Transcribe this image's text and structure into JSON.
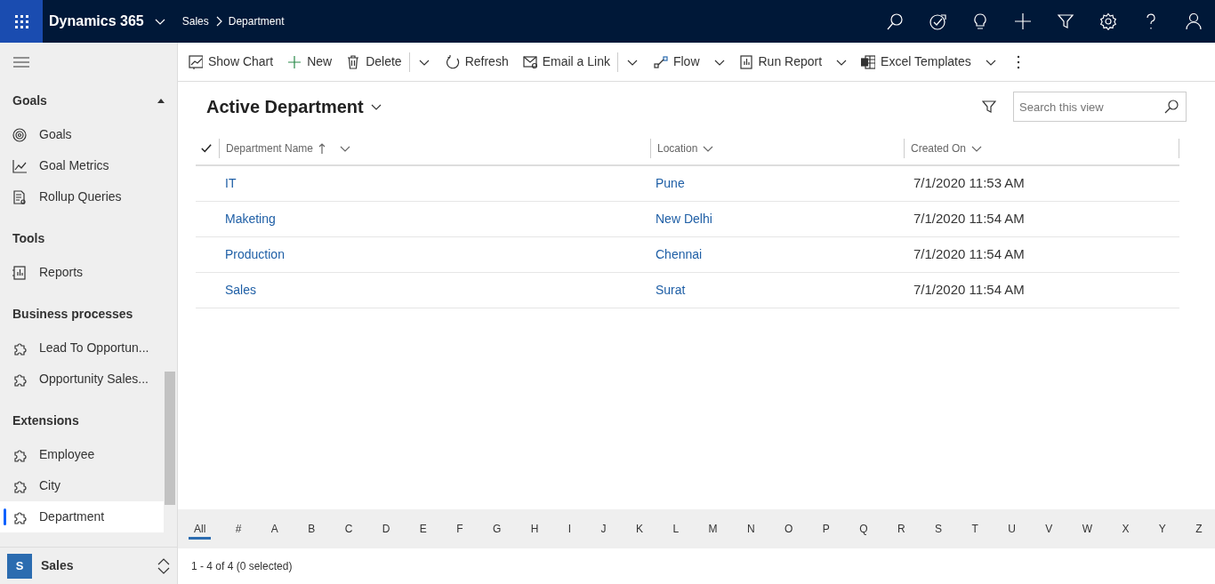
{
  "app": {
    "title": "Dynamics 365",
    "breadcrumb": [
      "Sales",
      "Department"
    ]
  },
  "commands": [
    {
      "kind": "button",
      "label": "Show Chart"
    },
    {
      "kind": "button",
      "label": "New"
    },
    {
      "kind": "button",
      "label": "Delete"
    },
    {
      "kind": "split"
    },
    {
      "kind": "button",
      "label": "Refresh"
    },
    {
      "kind": "button",
      "label": "Email a Link"
    },
    {
      "kind": "split"
    },
    {
      "kind": "menu",
      "label": "Flow"
    },
    {
      "kind": "menu",
      "label": "Run Report"
    },
    {
      "kind": "menu",
      "label": "Excel Templates"
    },
    {
      "kind": "more"
    }
  ],
  "sidebar": {
    "groups": [
      {
        "title": "Goals",
        "expanded": true,
        "items": [
          {
            "label": "Goals",
            "selected": false
          },
          {
            "label": "Goal Metrics",
            "selected": false
          },
          {
            "label": "Rollup Queries",
            "selected": false
          }
        ]
      },
      {
        "title": "Tools",
        "items": [
          {
            "label": "Reports",
            "selected": false
          }
        ]
      },
      {
        "title": "Business processes",
        "items": [
          {
            "label": "Lead To Opportun...",
            "selected": false
          },
          {
            "label": "Opportunity Sales...",
            "selected": false
          }
        ]
      },
      {
        "title": "Extensions",
        "items": [
          {
            "label": "Employee",
            "selected": false
          },
          {
            "label": "City",
            "selected": false
          },
          {
            "label": "Department",
            "selected": true
          }
        ]
      }
    ],
    "area": {
      "initial": "S",
      "label": "Sales"
    }
  },
  "view": {
    "title": "Active Department",
    "search": {
      "placeholder": "Search this view"
    }
  },
  "table": {
    "columns": [
      {
        "label": "Department Name",
        "sorted": true
      },
      {
        "label": "Location",
        "sorted": false
      },
      {
        "label": "Created On",
        "sorted": false
      }
    ],
    "rows": [
      {
        "cells": [
          "IT",
          "Pune",
          "7/1/2020 11:53 AM"
        ]
      },
      {
        "cells": [
          "Maketing",
          "New Delhi",
          "7/1/2020 11:54 AM"
        ]
      },
      {
        "cells": [
          "Production",
          "Chennai",
          "7/1/2020 11:54 AM"
        ]
      },
      {
        "cells": [
          "Sales",
          "Surat",
          "7/1/2020 11:54 AM"
        ]
      }
    ]
  },
  "alphabet": [
    {
      "label": "All",
      "selected": true
    },
    {
      "label": "#",
      "selected": false
    },
    {
      "label": "A",
      "selected": false
    },
    {
      "label": "B",
      "selected": false
    },
    {
      "label": "C",
      "selected": false
    },
    {
      "label": "D",
      "selected": false
    },
    {
      "label": "E",
      "selected": false
    },
    {
      "label": "F",
      "selected": false
    },
    {
      "label": "G",
      "selected": false
    },
    {
      "label": "H",
      "selected": false
    },
    {
      "label": "I",
      "selected": false
    },
    {
      "label": "J",
      "selected": false
    },
    {
      "label": "K",
      "selected": false
    },
    {
      "label": "L",
      "selected": false
    },
    {
      "label": "M",
      "selected": false
    },
    {
      "label": "N",
      "selected": false
    },
    {
      "label": "O",
      "selected": false
    },
    {
      "label": "P",
      "selected": false
    },
    {
      "label": "Q",
      "selected": false
    },
    {
      "label": "R",
      "selected": false
    },
    {
      "label": "S",
      "selected": false
    },
    {
      "label": "T",
      "selected": false
    },
    {
      "label": "U",
      "selected": false
    },
    {
      "label": "V",
      "selected": false
    },
    {
      "label": "W",
      "selected": false
    },
    {
      "label": "X",
      "selected": false
    },
    {
      "label": "Y",
      "selected": false
    },
    {
      "label": "Z",
      "selected": false
    }
  ],
  "status_bar": "1 - 4 of 4 (0 selected)"
}
